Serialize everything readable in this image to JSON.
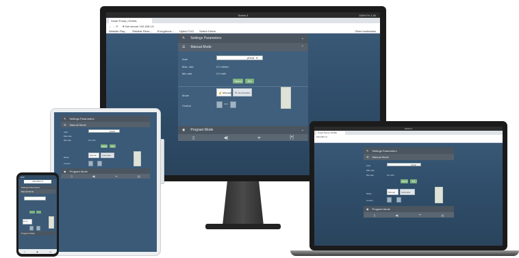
{
  "monitor": {
    "os_title": "Scribe.3",
    "os_status": "100%  Fri 1:30",
    "tab_title": "Smart Pump | DOMA",
    "url": "⊕ Not secure  192.168.1.6",
    "bookmarks": [
      "Website Play...",
      "Reliable Rene...",
      "Encryptions...",
      "Hybrid TUO",
      "Switch Delive"
    ],
    "bookmarks_right": "Other bookmarks",
    "settings_title": "Settings Parameters",
    "manual_title": "Manual Mode",
    "auto_label": "Auto",
    "select_value": "pHcal",
    "max_rate_label": "Max. rate",
    "max_rate_value": "0.0 ml/sec",
    "min_rate_label": "Min rate",
    "min_rate_value": "0.0 ml/h",
    "button_a": "Stand",
    "button_b": "Set",
    "mode_label": "Mode",
    "mode_a": "Manual",
    "mode_b": "Automatic",
    "control_label": "Control",
    "program_title": "Program Mode"
  },
  "tablet": {
    "settings_title": "Settings Parameters",
    "manual_title": "Manual Mode",
    "auto_label": "Auto",
    "select_value": "pHcal",
    "max_rate_label": "Max rate",
    "min_rate_label": "Min rate",
    "min_rate_value": "0.0 ml/h",
    "button_a": "Stand",
    "button_b": "Set",
    "mode_label": "Mode",
    "mode_a": "Manual",
    "mode_b": "Automatic",
    "control_label": "Control",
    "program_title": "Program Mode"
  },
  "phone": {
    "status_time": "9:41",
    "url": "192.168.1.6",
    "settings_title": "Settings Parameters",
    "manual_title": "Manual Mode",
    "mode_a": "Manual",
    "program_title": "Program Mode"
  },
  "laptop": {
    "os_title": "Scribe.3",
    "tab_title": "Smart Pump | DOMA",
    "url": "192.168.1.6",
    "settings_title": "Settings Parameters",
    "manual_title": "Manual Mode",
    "auto_label": "Auto",
    "select_value": "pHcal",
    "max_rate_label": "Max rate",
    "min_rate_label": "Min rate",
    "min_rate_value": "0.0 ml/h",
    "button_a": "Stand",
    "button_b": "Set",
    "mode_label": "Mode",
    "mode_a": "Manual",
    "mode_b": "Automatic",
    "control_label": "Control",
    "program_title": "Program Mode"
  },
  "colors": {
    "bezel": "#1d1d1d",
    "screen_blue": "#3b5c7a",
    "panel": "#e9ecef",
    "header": "#4a5560",
    "green_button": "#7fb37f",
    "footer": "#5a6672"
  },
  "icons": {
    "phone_icon": "phone-icon",
    "volume_icon": "volume-icon",
    "signal_icon": "signal-icon",
    "terminal_icon": "terminal-icon",
    "wrench_icon": "wrench-icon",
    "sliders_icon": "sliders-icon",
    "gauge_icon": "gauge-icon"
  }
}
